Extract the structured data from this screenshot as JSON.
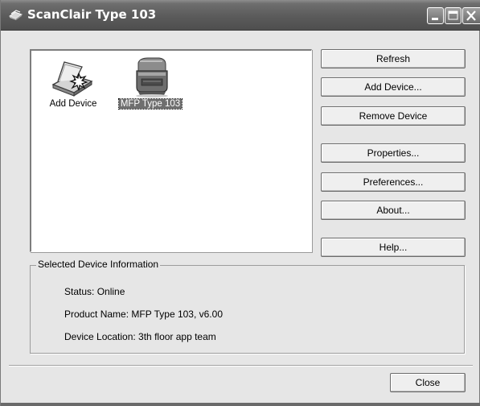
{
  "window": {
    "title": "ScanClair Type 103",
    "icon": "scanner-app-icon",
    "controls": [
      "minimize-icon",
      "maximize-icon",
      "close-icon"
    ]
  },
  "device_list": {
    "items": [
      {
        "label": "Add Device",
        "icon": "add-device-scanner-icon",
        "selected": false
      },
      {
        "label": "MFP Type 103",
        "icon": "mfp-printer-icon",
        "selected": true
      }
    ]
  },
  "buttons": {
    "refresh": "Refresh",
    "add_device": "Add Device...",
    "remove_device": "Remove Device",
    "properties": "Properties...",
    "preferences": "Preferences...",
    "about": "About...",
    "help": "Help...",
    "close": "Close"
  },
  "info": {
    "group_title": "Selected Device Information",
    "status": "Status: Online",
    "product_name": "Product Name: MFP Type 103, v6.00",
    "device_location": "Device Location: 3th floor app team"
  },
  "colors": {
    "titlebar": "#5b5b5b",
    "selection": "#6f6f6f",
    "dialog_bg": "#e6e6e6"
  }
}
